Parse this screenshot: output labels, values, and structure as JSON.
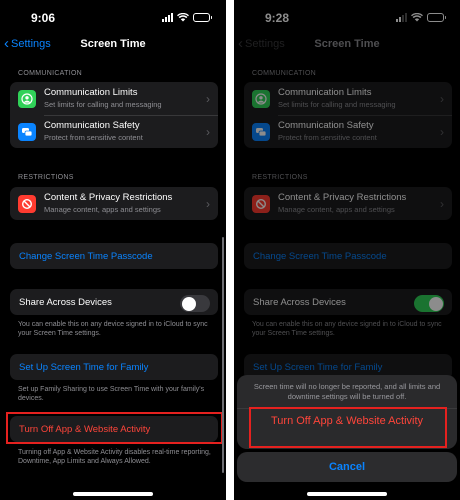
{
  "left": {
    "time": "9:06",
    "nav": {
      "back": "Settings",
      "title": "Screen Time"
    },
    "communication": {
      "header": "COMMUNICATION",
      "items": [
        {
          "title": "Communication Limits",
          "subtitle": "Set limits for calling and messaging"
        },
        {
          "title": "Communication Safety",
          "subtitle": "Protect from sensitive content"
        }
      ]
    },
    "restrictions": {
      "header": "RESTRICTIONS",
      "items": [
        {
          "title": "Content & Privacy Restrictions",
          "subtitle": "Manage content, apps and settings"
        }
      ]
    },
    "passcode": "Change Screen Time Passcode",
    "share": {
      "label": "Share Across Devices",
      "note": "You can enable this on any device signed in to iCloud to sync your Screen Time settings.",
      "enabled": false
    },
    "family": {
      "label": "Set Up Screen Time for Family",
      "note": "Set up Family Sharing to use Screen Time with your family's devices."
    },
    "turnoff": {
      "label": "Turn Off App & Website Activity",
      "note": "Turning off App & Website Activity disables real-time reporting, Downtime, App Limits and Always Allowed."
    }
  },
  "right": {
    "time": "9:28",
    "nav": {
      "back": "Settings",
      "title": "Screen Time"
    },
    "communication": {
      "header": "COMMUNICATION",
      "items": [
        {
          "title": "Communication Limits",
          "subtitle": "Set limits for calling and messaging"
        },
        {
          "title": "Communication Safety",
          "subtitle": "Protect from sensitive content"
        }
      ]
    },
    "restrictions": {
      "header": "RESTRICTIONS",
      "items": [
        {
          "title": "Content & Privacy Restrictions",
          "subtitle": "Manage content, apps and settings"
        }
      ]
    },
    "passcode": "Change Screen Time Passcode",
    "share": {
      "label": "Share Across Devices",
      "note": "You can enable this on any device signed in to iCloud to sync your Screen Time settings.",
      "enabled": true
    },
    "family": {
      "label": "Set Up Screen Time for Family"
    },
    "sheet": {
      "message": "Screen time will no longer be reported, and all limits and downtime settings will be turned off.",
      "action": "Turn Off App & Website Activity",
      "cancel": "Cancel"
    }
  },
  "colors": {
    "accent_blue": "#0a84ff",
    "destructive_red": "#ff453a",
    "toggle_on": "#30d158",
    "highlight": "#e5211f",
    "icon_green": "#30d158",
    "icon_blue": "#0a84ff",
    "icon_red": "#ff3b30"
  }
}
